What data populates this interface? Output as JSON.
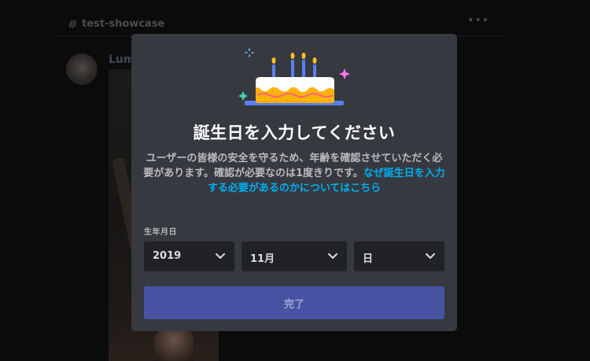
{
  "background": {
    "channel_name": "test-showcase",
    "username": "Lum",
    "more_icon": "more-horizontal-icon"
  },
  "modal": {
    "illustration": "birthday-cake-icon",
    "title": "誕生日を入力してください",
    "description": "ユーザーの皆様の安全を守るため、年齢を確認させていただく必要があります。確認が必要なのは1度きりです。",
    "link_text": "なぜ誕生日を入力する必要があるのかについてはこちら",
    "dob_label": "生年月日",
    "year": {
      "value": "2019"
    },
    "month": {
      "value": "11月"
    },
    "day": {
      "placeholder": "日"
    },
    "submit_label": "完了"
  },
  "colors": {
    "modal_bg": "#36393f",
    "select_bg": "#202225",
    "link": "#00aff4",
    "button_disabled": "#4752a3",
    "title": "#ffffff",
    "body_text": "#b9bbbe"
  }
}
